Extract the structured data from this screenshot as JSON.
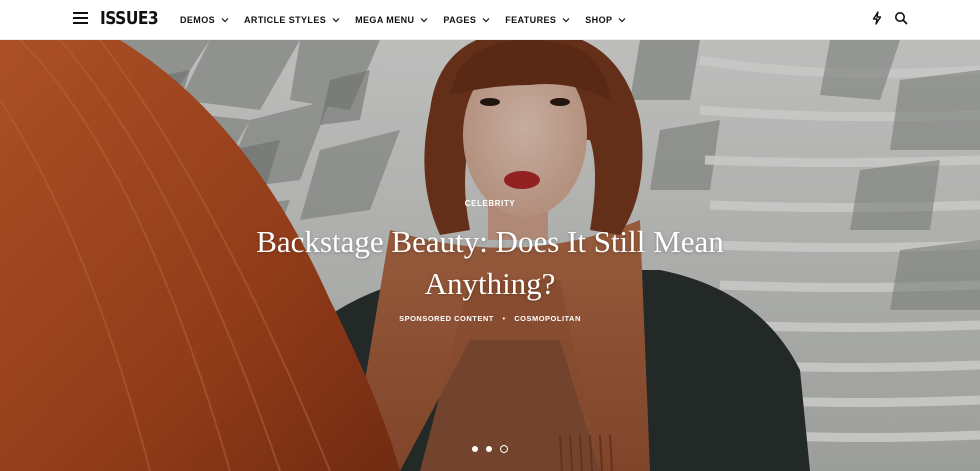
{
  "header": {
    "logo": "ISSUE3",
    "nav": [
      {
        "label": "DEMOS"
      },
      {
        "label": "ARTICLE STYLES"
      },
      {
        "label": "MEGA MENU"
      },
      {
        "label": "PAGES"
      },
      {
        "label": "FEATURES"
      },
      {
        "label": "SHOP"
      }
    ],
    "icons": [
      "menu-icon",
      "bolt-icon",
      "search-icon"
    ]
  },
  "hero": {
    "category": "CELEBRITY",
    "title": "Backstage Beauty: Does It Still Mean Anything?",
    "meta": {
      "author": "SPONSORED CONTENT",
      "separator": "•",
      "source": "COSMOPOLITAN"
    },
    "slides": 3,
    "active_slide": 3
  },
  "colors": {
    "header_bg": "#ffffff",
    "text_dark": "#111111",
    "hero_text": "#ffffff",
    "scarf": "#b06a45",
    "hair": "#c4582c",
    "coat": "#2b3230"
  }
}
